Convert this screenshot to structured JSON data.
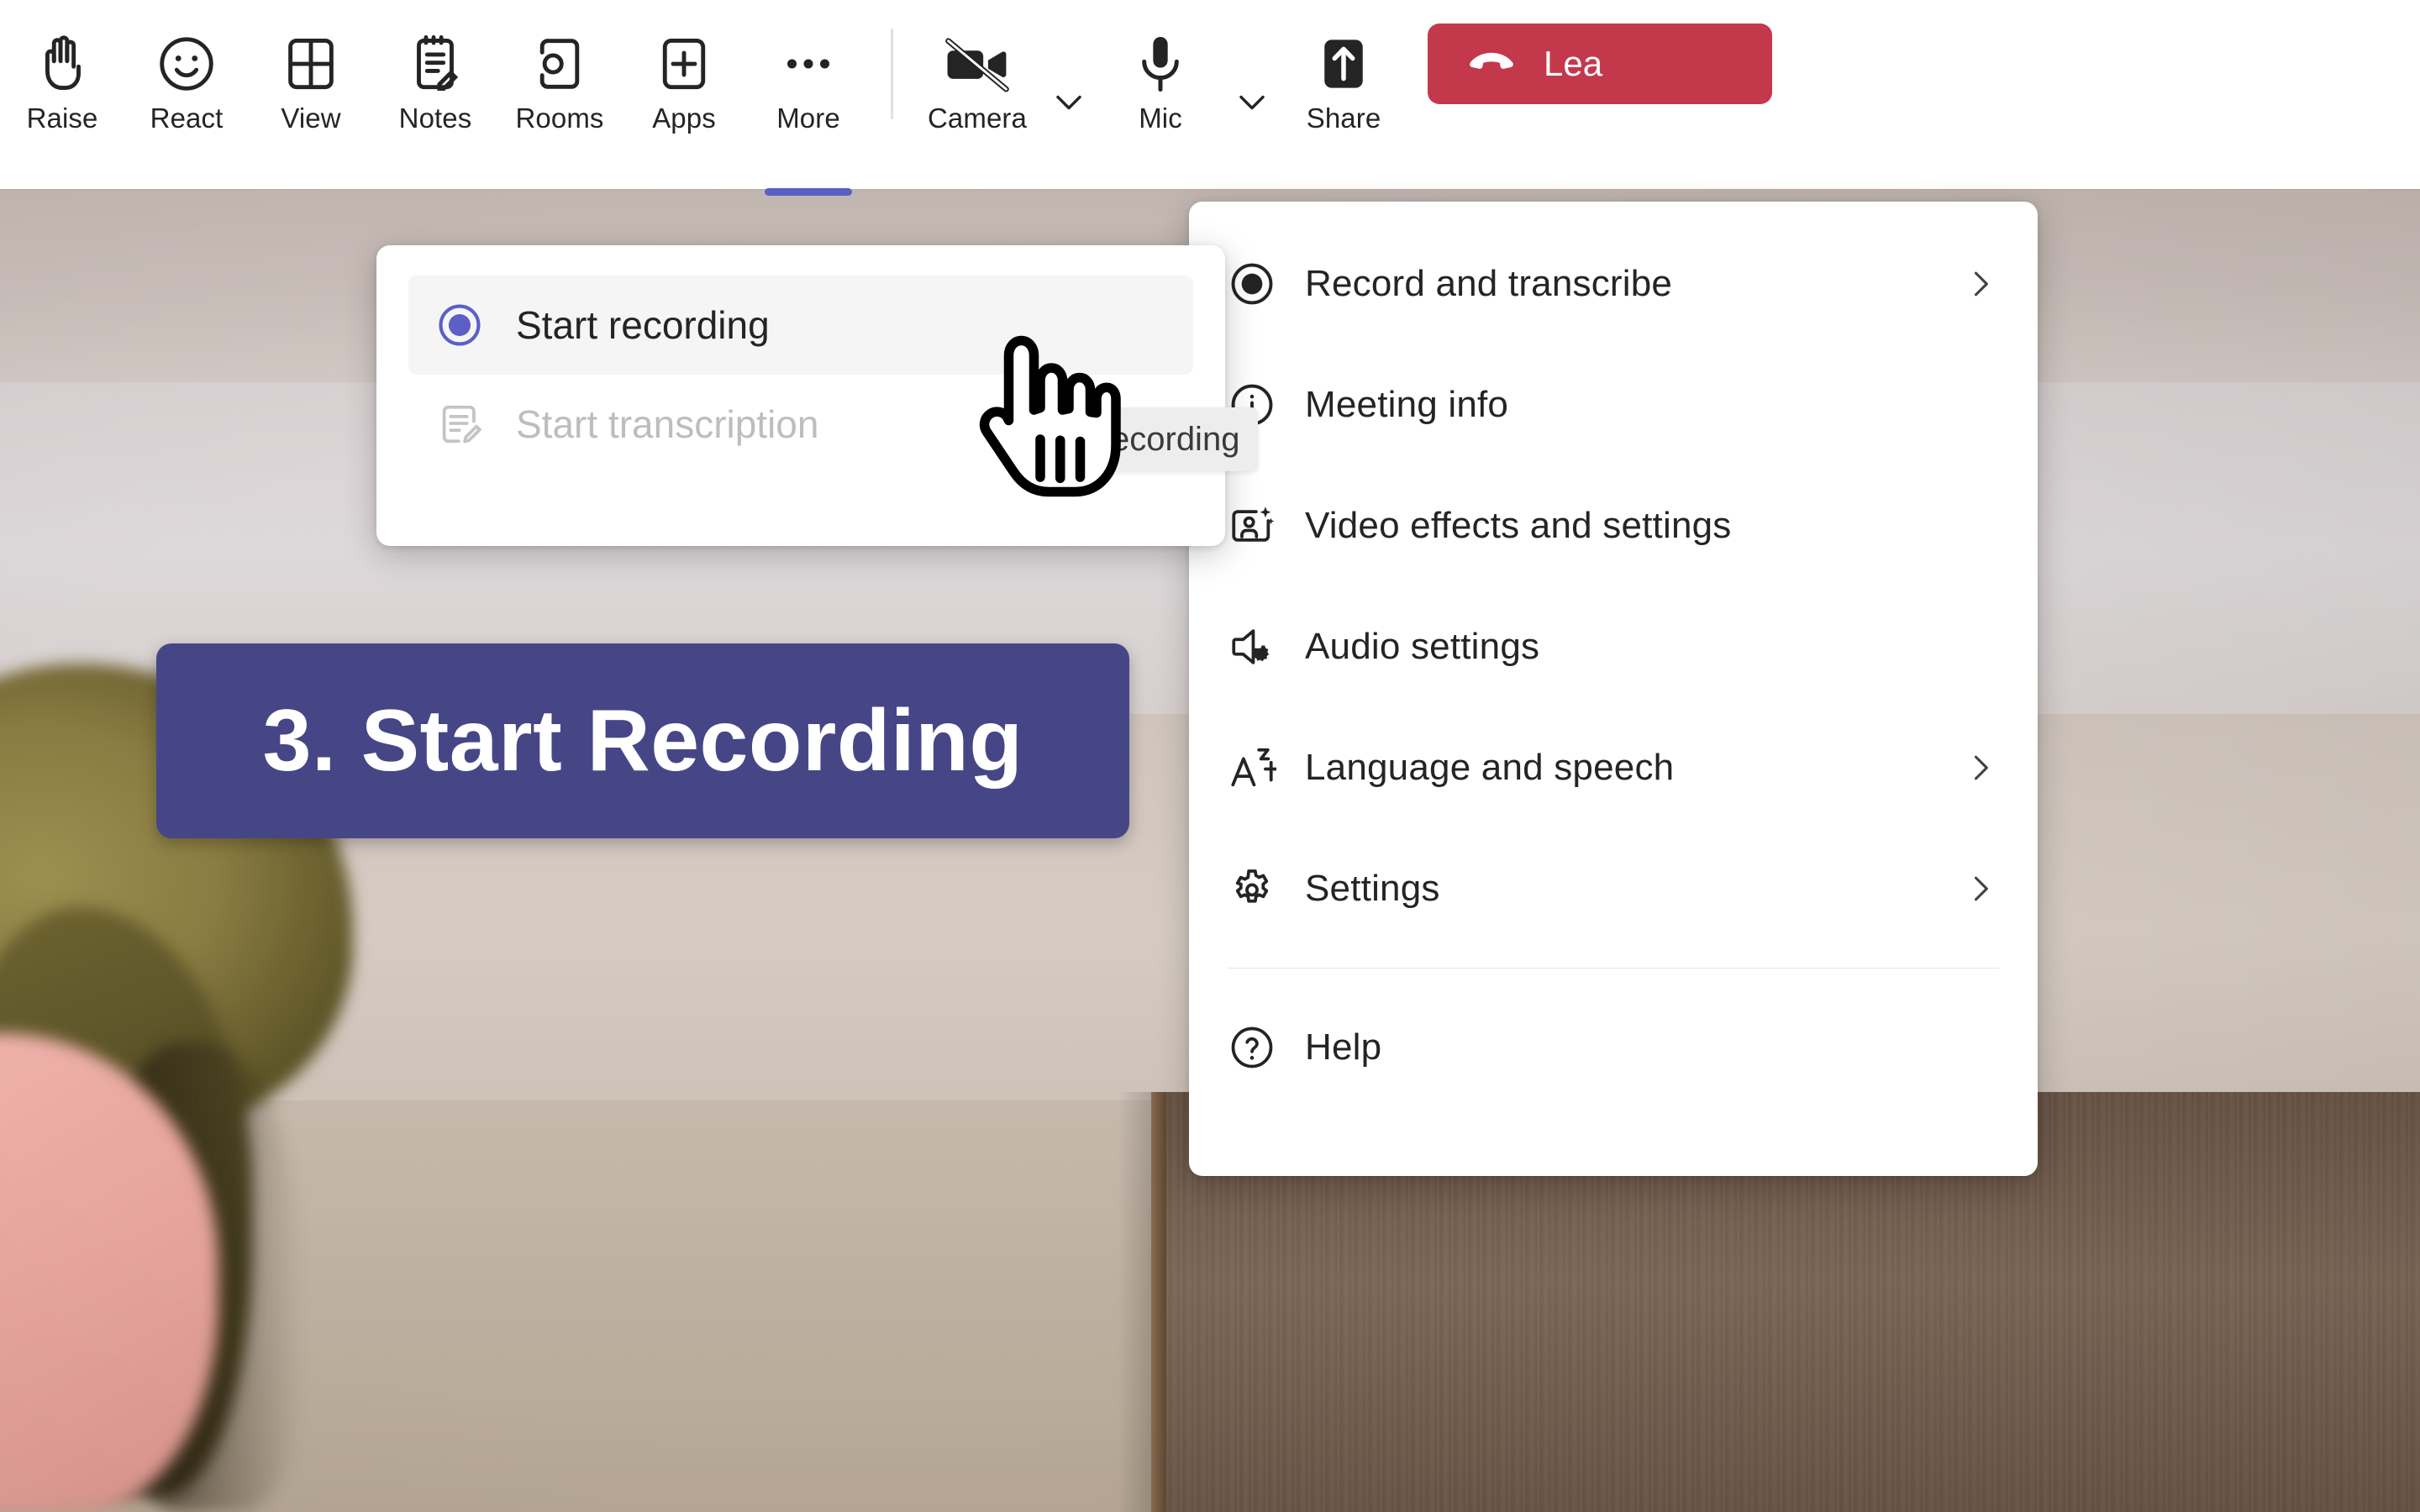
{
  "app": {
    "name": "Microsoft Teams meeting",
    "brand_color": "#5b5fc7",
    "leave_color": "#c4384b",
    "banner_color": "#464687"
  },
  "toolbar": {
    "items": [
      {
        "label": "Raise",
        "icon": "raise-hand-icon",
        "active": false
      },
      {
        "label": "React",
        "icon": "emoji-smile-icon",
        "active": false
      },
      {
        "label": "View",
        "icon": "grid-view-icon",
        "active": false
      },
      {
        "label": "Notes",
        "icon": "notes-icon",
        "active": false
      },
      {
        "label": "Rooms",
        "icon": "breakout-rooms-icon",
        "active": false
      },
      {
        "label": "Apps",
        "icon": "plus-apps-icon",
        "active": false
      },
      {
        "label": "More",
        "icon": "more-ellipsis-icon",
        "active": true
      }
    ],
    "camera": {
      "label": "Camera",
      "icon": "camera-off-icon",
      "caret": "chevron-down-icon"
    },
    "mic": {
      "label": "Mic",
      "icon": "microphone-icon",
      "caret": "chevron-down-icon"
    },
    "share": {
      "label": "Share",
      "icon": "share-screen-icon"
    },
    "leave": {
      "label": "Lea",
      "icon": "hangup-phone-icon"
    }
  },
  "more_menu": {
    "items": [
      {
        "label": "Record and transcribe",
        "icon": "record-circle-icon",
        "chevron": true
      },
      {
        "label": "Meeting info",
        "icon": "info-circle-icon",
        "chevron": false
      },
      {
        "label": "Video effects and settings",
        "icon": "video-effects-icon",
        "chevron": false
      },
      {
        "label": "Audio settings",
        "icon": "speaker-settings-icon",
        "chevron": false
      },
      {
        "label": "Language and speech",
        "icon": "language-icon",
        "chevron": true
      },
      {
        "label": "Settings",
        "icon": "gear-icon",
        "chevron": true
      }
    ],
    "help": {
      "label": "Help",
      "icon": "help-circle-icon"
    }
  },
  "record_submenu": {
    "items": [
      {
        "label": "Start recording",
        "icon": "record-radio-icon",
        "state": "enabled"
      },
      {
        "label": "Start transcription",
        "icon": "transcription-icon",
        "state": "disabled"
      }
    ]
  },
  "tooltip": {
    "text": "ecording"
  },
  "banner": {
    "text": "3. Start Recording"
  },
  "cursor": {
    "icon": "pointing-hand-cursor"
  }
}
